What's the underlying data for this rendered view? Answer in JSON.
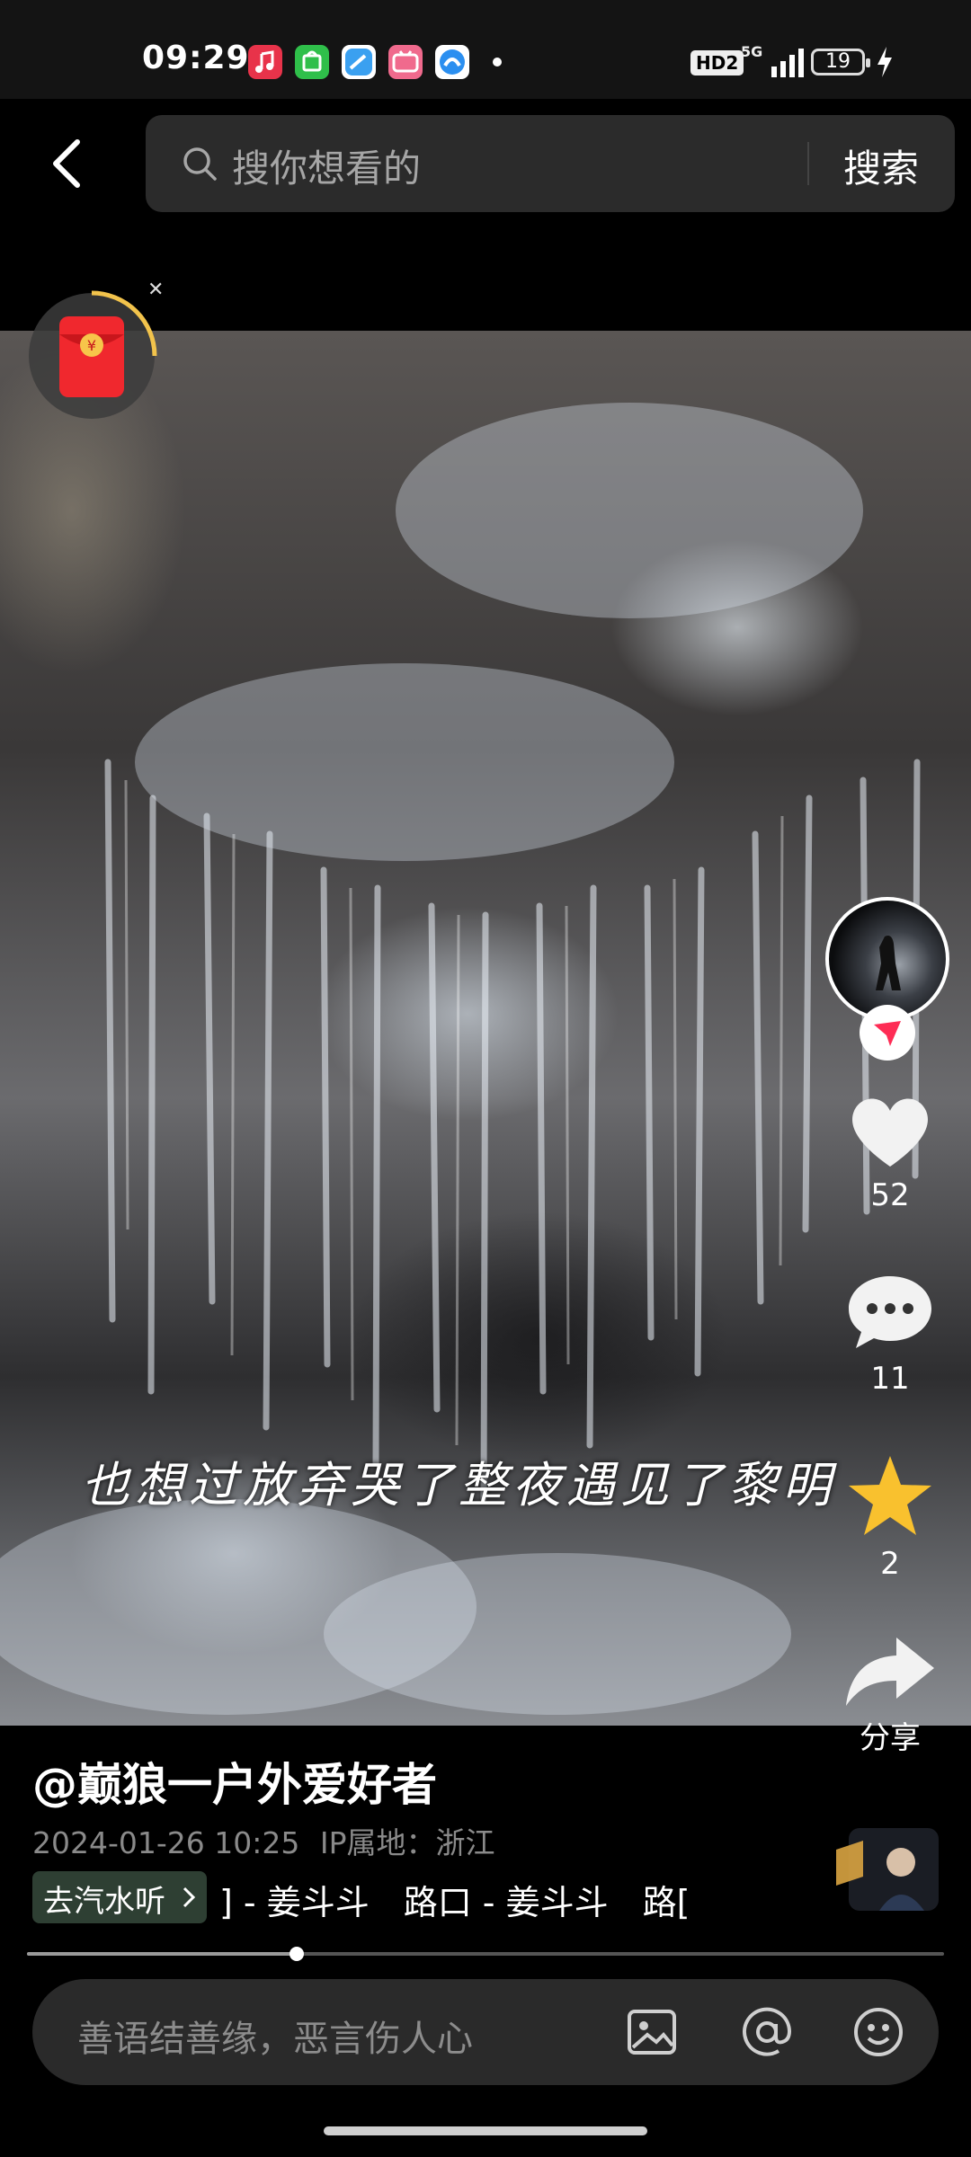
{
  "status_bar": {
    "time": "09:29",
    "hd_label": "HD2",
    "network": "5G",
    "battery": "19",
    "app_icons": [
      {
        "name": "music-app-icon",
        "color": "#e8334a"
      },
      {
        "name": "shop-app-icon",
        "color": "#2fbf4a"
      },
      {
        "name": "browser-app-icon",
        "color": "#3aa0f0"
      },
      {
        "name": "bilibili-app-icon",
        "color": "#f06a8d"
      },
      {
        "name": "cloud-app-icon",
        "color": "#2b8ff0"
      }
    ]
  },
  "search": {
    "placeholder": "搜你想看的",
    "button": "搜索"
  },
  "video": {
    "caption": "也想过放弃哭了整夜遇见了黎明"
  },
  "actions": {
    "likes": "52",
    "comments": "11",
    "favorites": "2",
    "share_label": "分享"
  },
  "post": {
    "author": "@巅狼一户外爱好者",
    "datetime": "2024-01-26 10:25",
    "ip_location": "IP属地：浙江",
    "music_button": "去汽水听",
    "music_ticker": "] - 姜斗斗　路口 - 姜斗斗　路[",
    "progress_fraction": 0.294
  },
  "comment_bar": {
    "placeholder": "善语结善缘，恶言伤人心"
  },
  "colors": {
    "accent_red": "#fe2c55",
    "favorite_yellow": "#f9c12e",
    "music_button_bg": "#2e3f33"
  }
}
